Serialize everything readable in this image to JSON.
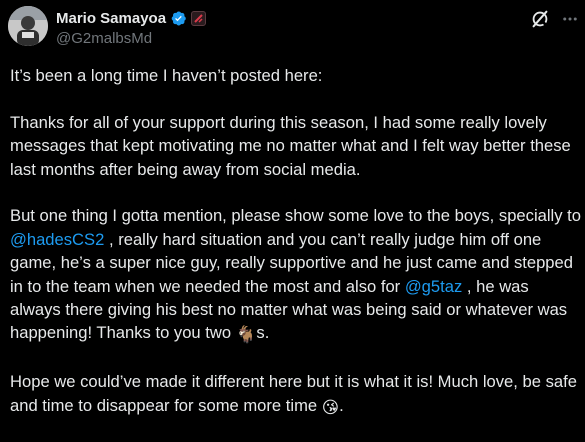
{
  "author": {
    "name": "Mario Samayoa",
    "handle": "@G2malbsMd",
    "avatar_icon": "avatar-photo",
    "verified_icon": "verified-badge-icon",
    "affiliation_icon": "g2-affiliate-badge-icon"
  },
  "actions": {
    "grok_icon": "grok-icon",
    "more_icon": "more-options-icon"
  },
  "tweet": {
    "p1": "It’s been a long time I haven’t posted here:",
    "p2": "Thanks for all of your support during this season, I had some really lovely messages that kept motivating me no matter what and I felt way better these last months after being away from social media.",
    "p3_a": "But one thing I gotta mention, please show some love to the boys, specially to",
    "mention1": "@hadesCS2",
    "p3_b": ", really hard situation and you can’t really judge him off one game, he’s a super nice guy, really supportive and he just came and stepped in to the team when we needed the most and also for",
    "mention2": "@g5taz",
    "p3_c": ", he was always there giving his best no matter what was being said or whatever was happening! Thanks to you two",
    "p3_emoji": "🐐",
    "p3_d": "s.",
    "p4": "Hope we could’ve made it different here but it is what it is! Much love, be safe and time to disappear for some more time",
    "p4_emoji": "😘",
    "p4_end": "."
  },
  "colors": {
    "background": "#000000",
    "text": "#e7e9ea",
    "secondary": "#71767b",
    "link": "#1d9bf0",
    "verified": "#1d9bf0"
  }
}
